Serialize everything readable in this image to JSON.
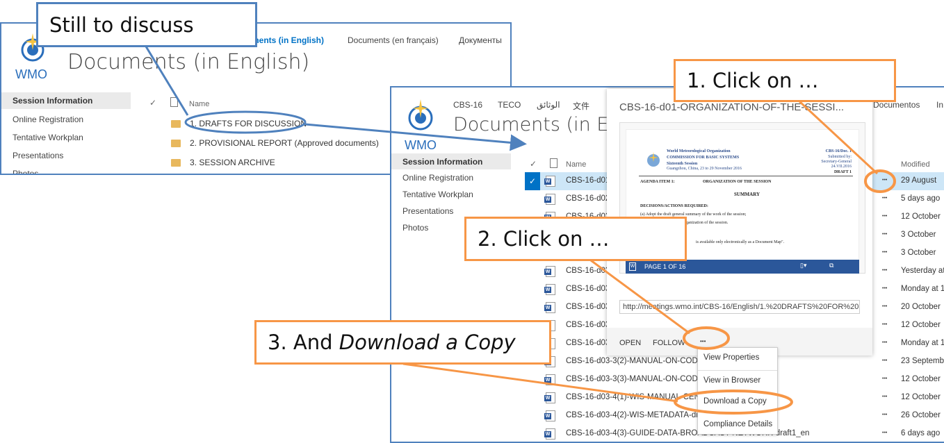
{
  "back_window": {
    "nav": [
      "Documents (in English)",
      "Documents (en français)",
      "Документы"
    ],
    "title": "Documents (in English)",
    "logo_text": "WMO",
    "sidebar": [
      "Session Information",
      "Online Registration",
      "Tentative Workplan",
      "Presentations",
      "Photos"
    ],
    "column_name": "Name",
    "folders": [
      "1. DRAFTS FOR DISCUSSION",
      "2. PROVISIONAL REPORT (Approved documents)",
      "3. SESSION ARCHIVE"
    ]
  },
  "front_window": {
    "nav": [
      "CBS-16",
      "TECO",
      "الوثائق",
      "文件",
      "Documentos",
      "In"
    ],
    "title": "Documents (in English)",
    "logo_text": "WMO",
    "sidebar": [
      "Session Information",
      "Online Registration",
      "Tentative Workplan",
      "Presentations",
      "Photos"
    ],
    "column_name": "Name",
    "column_modified": "Modified",
    "rows": [
      {
        "name": "CBS-16-d01",
        "modified": "29 August",
        "selected": true
      },
      {
        "name": "CBS-16-d02",
        "modified": "5 days ago"
      },
      {
        "name": "CBS-16-d03",
        "modified": "12 October"
      },
      {
        "name": "CBS-16-d03",
        "modified": "3 October"
      },
      {
        "name": "CBS-16-d03",
        "modified": "3 October"
      },
      {
        "name": "CBS-16-d03",
        "modified": "Yesterday at"
      },
      {
        "name": "CBS-16-d03",
        "modified": "Monday at 1"
      },
      {
        "name": "CBS-16-d03",
        "modified": "20 October"
      },
      {
        "name": "CBS-16-d03",
        "modified": "12 October"
      },
      {
        "name": "CBS-16-d03",
        "modified": "Monday at 1"
      },
      {
        "name": "CBS-16-d03-3(2)-MANUAL-ON-CODE",
        "modified": "23 Septemb"
      },
      {
        "name": "CBS-16-d03-3(3)-MANUAL-ON-CODE",
        "modified": "12 October"
      },
      {
        "name": "CBS-16-d03-4(1)-WIS-MANUAL-CENT",
        "modified": "12 October"
      },
      {
        "name": "CBS-16-d03-4(2)-WIS-METADATA-dra",
        "modified": "26 October"
      },
      {
        "name": "CBS-16-d03-4(3)-GUIDE-DATA-BROADCAST-NETWORK-draft1_en",
        "modified": "6 days ago"
      }
    ],
    "ellipsis": "•••"
  },
  "popup": {
    "title": "CBS-16-d01-ORGANIZATION-OF-THE-SESSI...",
    "doc": {
      "org": "World Meteorological Organization",
      "commission": "COMMISSION FOR BASIC SYSTEMS",
      "session": "Sixteenth Session",
      "place": "Guangzhou, China, 23 to 29 November 2016",
      "ref": "CBS-16/Doc. 1",
      "submitted": "Submitted by:",
      "by": "Secretary-General",
      "date": "24.VII.2016",
      "draft": "DRAFT 1",
      "agenda": "AGENDA ITEM 1:",
      "agenda_title": "ORGANIZATION OF THE SESSION",
      "summary": "SUMMARY",
      "decisions": "DECISIONS/ACTIONS REQUIRED:",
      "line1": "(a)   Adopt the draft general summary of the work of the session;",
      "line2": "Decision 1/1 — Organization of the session.",
      "line3": "is available only electronically as a Document Map\"."
    },
    "page_label": "PAGE 1 OF 16",
    "url": "http://meetings.wmo.int/CBS-16/English/1.%20DRAFTS%20FOR%20",
    "open": "OPEN",
    "follow": "FOLLOW",
    "more": "•••"
  },
  "menu": [
    "View Properties",
    "View in Browser",
    "Download a Copy",
    "Compliance Details"
  ],
  "callouts": {
    "c0": "Still to discuss",
    "c1": "1. Click on …",
    "c2": "2. Click on …",
    "c3_prefix": "3. And ",
    "c3_em": "Download a Copy"
  },
  "colors": {
    "callout_orange": "#f79646",
    "callout_blue": "#4f81bd",
    "selected_row": "#cde6f7",
    "word_blue": "#2b579a"
  }
}
